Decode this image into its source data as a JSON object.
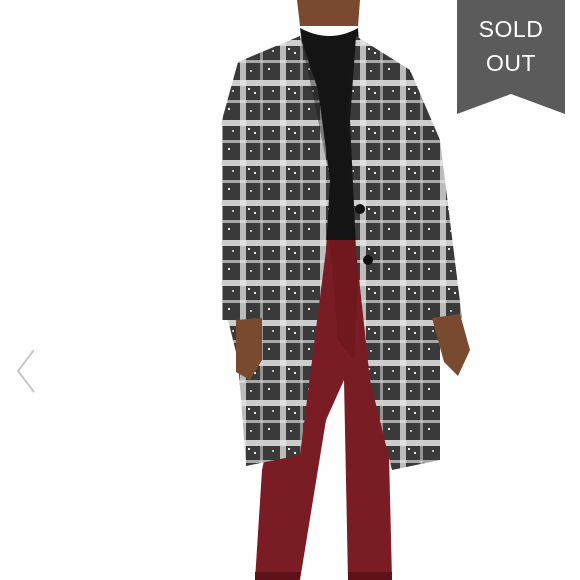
{
  "listing": {
    "badge_line1": "SOLD",
    "badge_line2": "OUT",
    "badge_color": "#5b5b5b"
  },
  "gallery": {
    "prev_icon": "chevron-left-icon",
    "image_subject": "plaid-coat-model-icon"
  },
  "colors": {
    "coat_dark": "#2a2a2a",
    "coat_light": "#e9e9e9",
    "turtleneck": "#141414",
    "pants": "#7a1c24",
    "skin": "#7a4a30"
  }
}
